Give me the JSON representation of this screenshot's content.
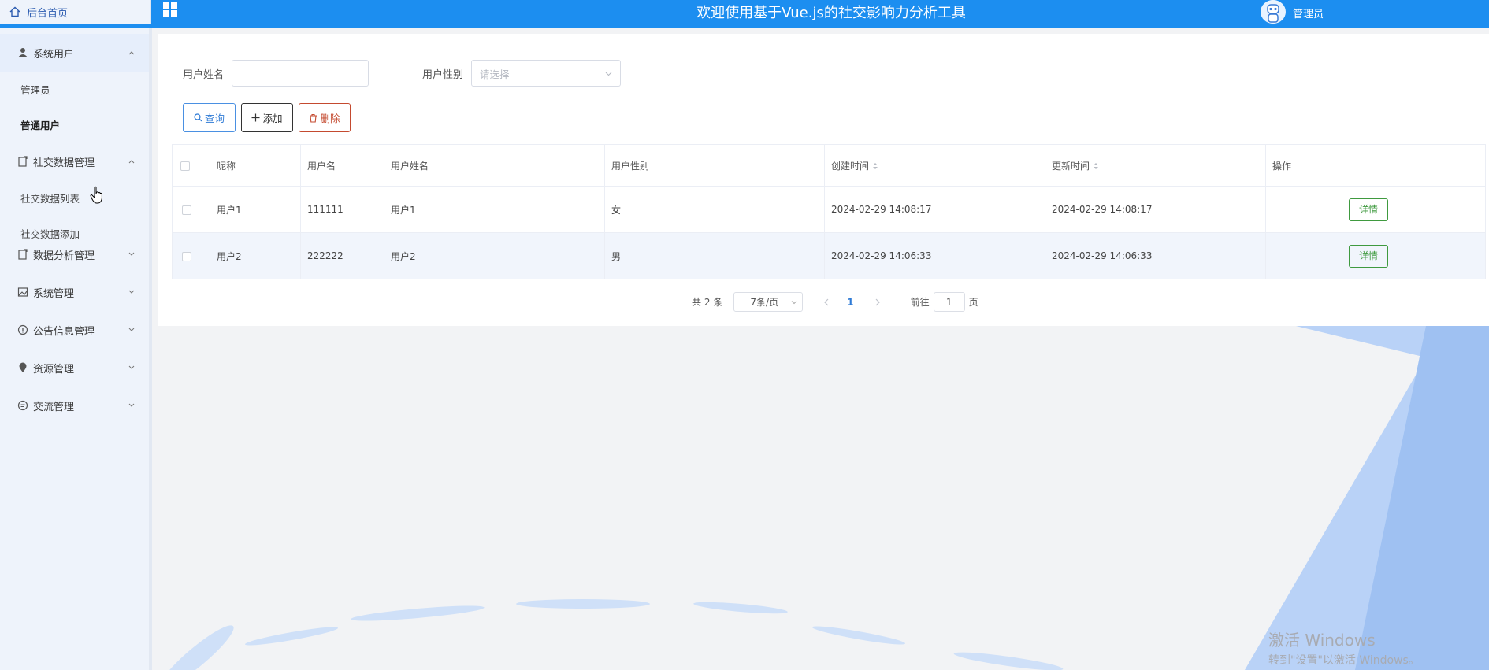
{
  "header": {
    "home_label": "后台首页",
    "title": "欢迎使用基于Vue.js的社交影响力分析工具",
    "user_label": "管理员"
  },
  "sidebar": {
    "groups": [
      {
        "label": "系统用户",
        "icon": "user-icon",
        "open": true,
        "items": [
          "管理员",
          "普通用户"
        ],
        "active": "普通用户"
      },
      {
        "label": "社交数据管理",
        "icon": "doc-icon",
        "open": true,
        "items": [
          "社交数据列表",
          "社交数据添加"
        ]
      },
      {
        "label": "数据分析管理",
        "icon": "doc-icon",
        "open": false
      },
      {
        "label": "系统管理",
        "icon": "image-icon",
        "open": false
      },
      {
        "label": "公告信息管理",
        "icon": "info-icon",
        "open": false
      },
      {
        "label": "资源管理",
        "icon": "location-icon",
        "open": false
      },
      {
        "label": "交流管理",
        "icon": "chat-icon",
        "open": false
      }
    ]
  },
  "filters": {
    "name_label": "用户姓名",
    "name_value": "",
    "gender_label": "用户性别",
    "gender_placeholder": "请选择"
  },
  "toolbar": {
    "query_label": "查询",
    "add_label": "添加",
    "delete_label": "删除"
  },
  "table": {
    "headers": [
      "昵称",
      "用户名",
      "用户姓名",
      "用户性别",
      "创建时间",
      "更新时间",
      "操作"
    ],
    "rows": [
      {
        "nickname": "用户1",
        "username": "111111",
        "realname": "用户1",
        "gender": "女",
        "created": "2024-02-29 14:08:17",
        "updated": "2024-02-29 14:08:17",
        "action": "详情"
      },
      {
        "nickname": "用户2",
        "username": "222222",
        "realname": "用户2",
        "gender": "男",
        "created": "2024-02-29 14:06:33",
        "updated": "2024-02-29 14:06:33",
        "action": "详情"
      }
    ]
  },
  "pagination": {
    "total_text": "共 2 条",
    "page_size": "7条/页",
    "current_page": "1",
    "goto_label": "前往",
    "goto_value": "1",
    "page_suffix": "页"
  },
  "watermark": {
    "line1": "激活 Windows",
    "line2": "转到\"设置\"以激活 Windows。"
  },
  "colors": {
    "header_bg": "#1c8ef0",
    "sidebar_bg": "#eef3fb",
    "query_border": "#4a90e2",
    "delete_border": "#c44a2f",
    "detail_border": "#3f9a3f"
  }
}
